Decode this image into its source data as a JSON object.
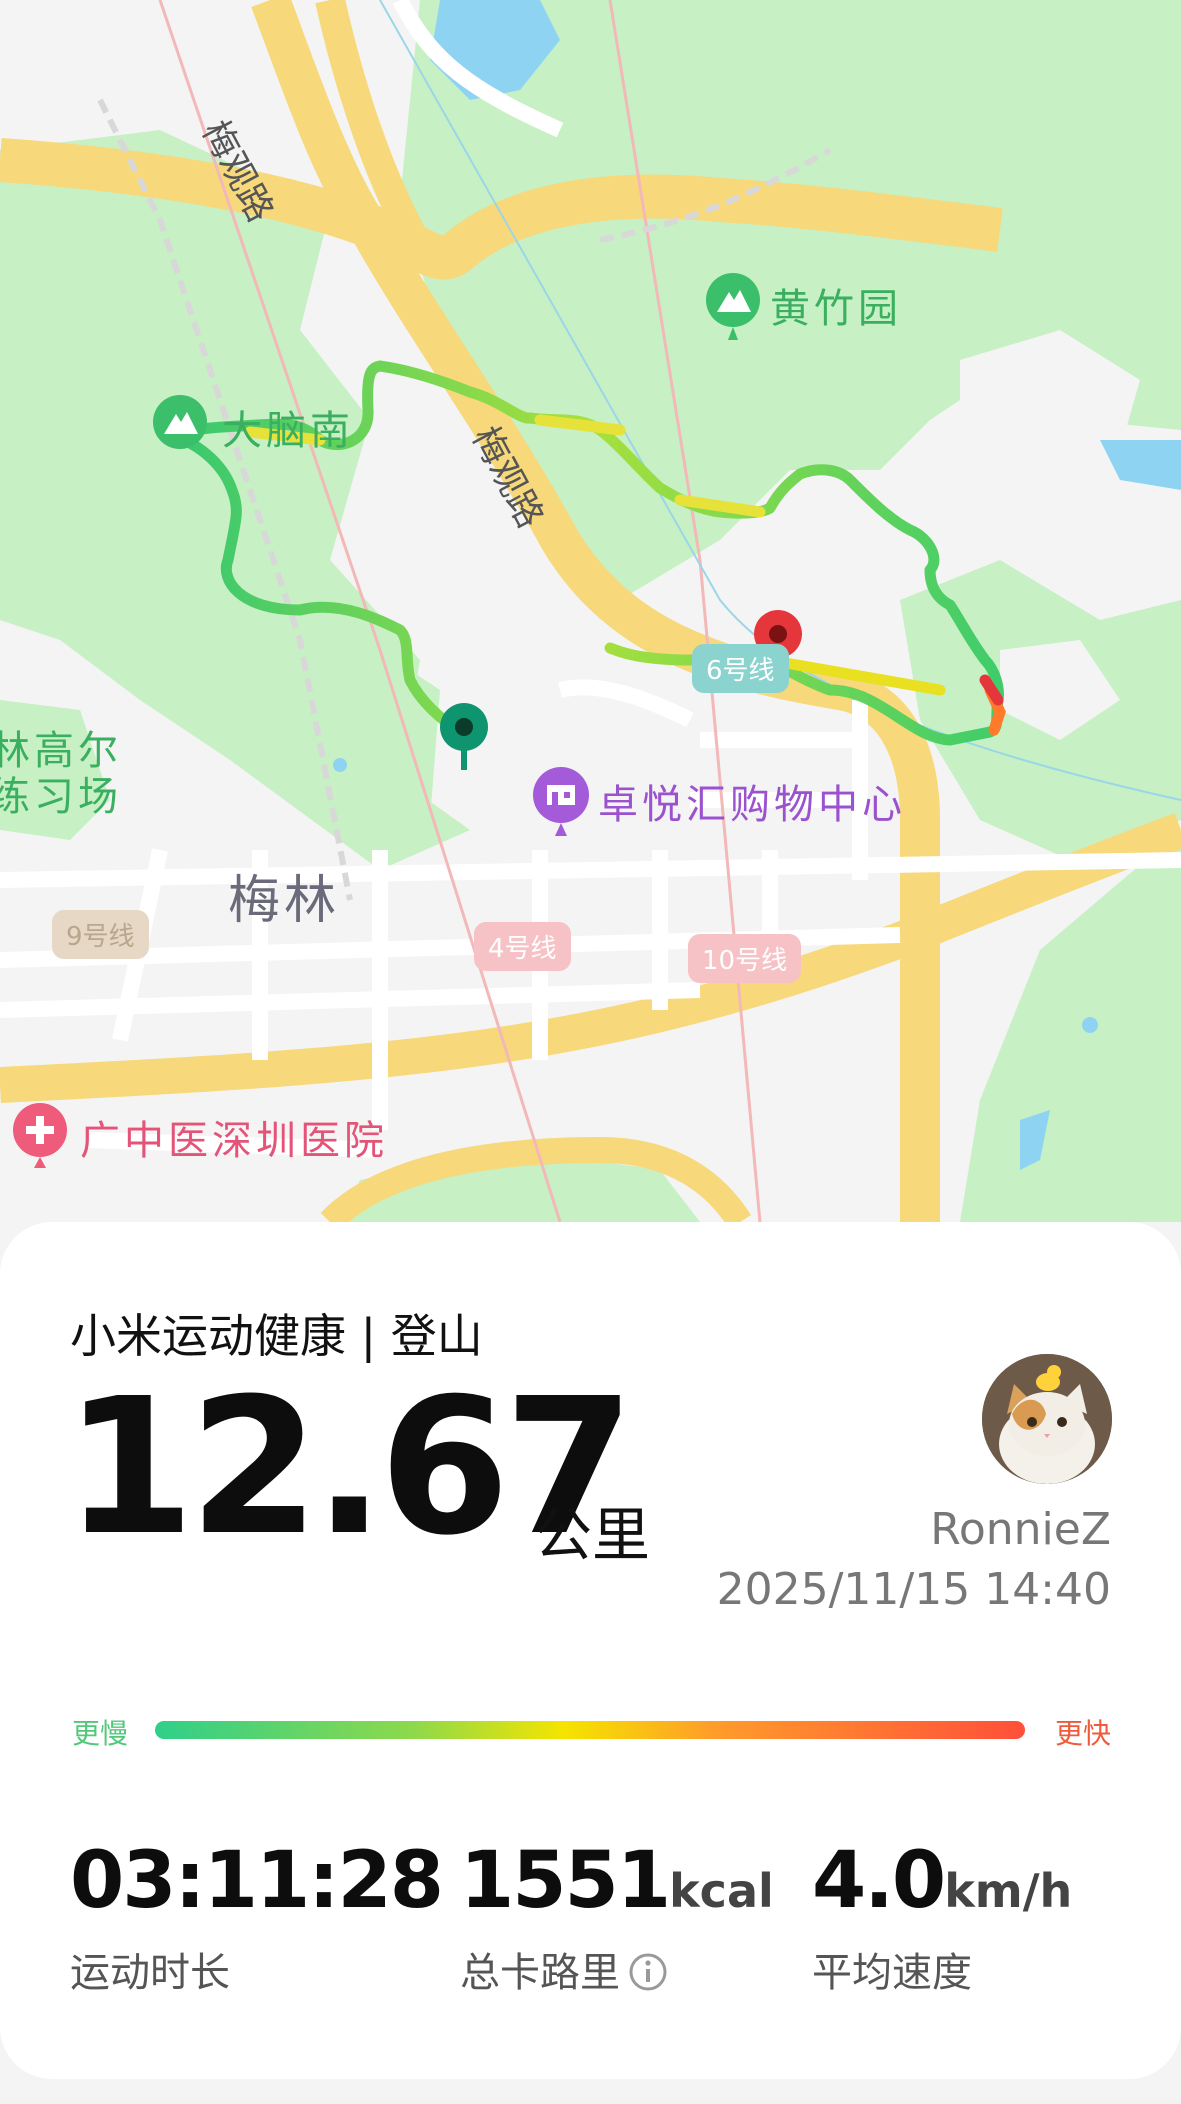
{
  "map": {
    "road_name": "梅观路",
    "pois": {
      "huangzhuyuan": "黄竹园",
      "danaonan": "大脑南",
      "zhuoyuehui": "卓悦汇购物中心",
      "meilin": "梅林",
      "golf_line1": "林高尔",
      "golf_line2": "练习场",
      "hospital": "广中医深圳医院"
    },
    "metro_lines": {
      "line6": "6号线",
      "line9": "9号线",
      "line4": "4号线",
      "line10": "10号线"
    }
  },
  "card": {
    "app_title": "小米运动健康 | 登山",
    "distance": "12.67",
    "distance_unit": "公里",
    "username": "RonnieZ",
    "datetime": "2025/11/15 14:40",
    "legend_slow": "更慢",
    "legend_fast": "更快",
    "stats": [
      {
        "value": "03:11:28",
        "unit": "",
        "label": "运动时长"
      },
      {
        "value": "1551",
        "unit": "kcal",
        "label": "总卡路里"
      },
      {
        "value": "4.0",
        "unit": "km/h",
        "label": "平均速度"
      }
    ]
  },
  "icons": [
    "mountain-poi-icon",
    "shopping-poi-icon",
    "hospital-poi-icon",
    "start-pin-icon",
    "end-pin-icon",
    "info-icon"
  ],
  "colors": {
    "park_green": "#c6f2c3",
    "road_yellow": "#f7d87a",
    "water_blue": "#8fd3f3",
    "start_pin": "#0f9470",
    "end_pin": "#e5373b",
    "slow": "#52c87a",
    "fast": "#f05a3a"
  }
}
